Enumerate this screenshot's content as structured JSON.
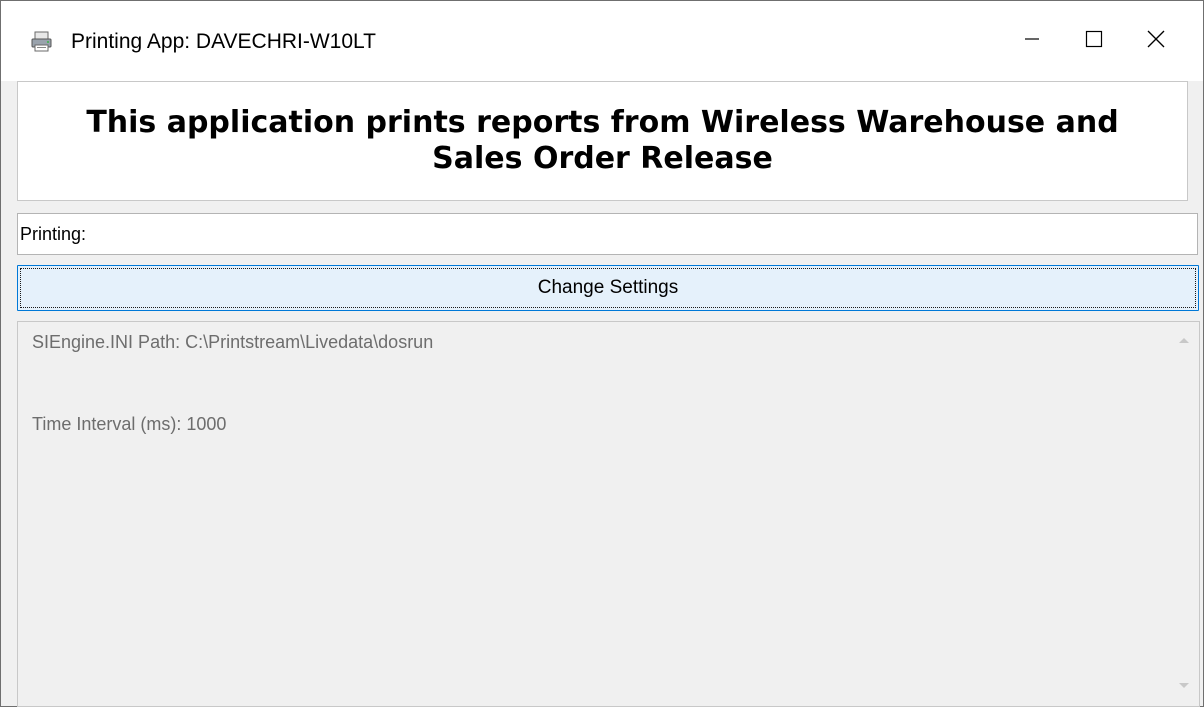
{
  "window": {
    "title": "Printing App: DAVECHRI-W10LT",
    "app_icon": "printer-app-icon",
    "controls": {
      "minimize_icon": "minimize-icon",
      "maximize_icon": "maximize-icon",
      "close_icon": "close-icon"
    }
  },
  "banner": {
    "text": "This application prints reports from Wireless Warehouse and Sales Order Release"
  },
  "printing": {
    "label": "Printing:",
    "value": ""
  },
  "settings_button": {
    "label": "Change Settings"
  },
  "info": {
    "lines": [
      "SIEngine.INI Path: C:\\Printstream\\Livedata\\dosrun",
      "Time Interval (ms): 1000"
    ]
  },
  "colors": {
    "button_bg": "#e5f1fb",
    "button_border": "#0078d7",
    "info_text": "#6d6d6d",
    "window_bg": "#f0f0f0"
  }
}
